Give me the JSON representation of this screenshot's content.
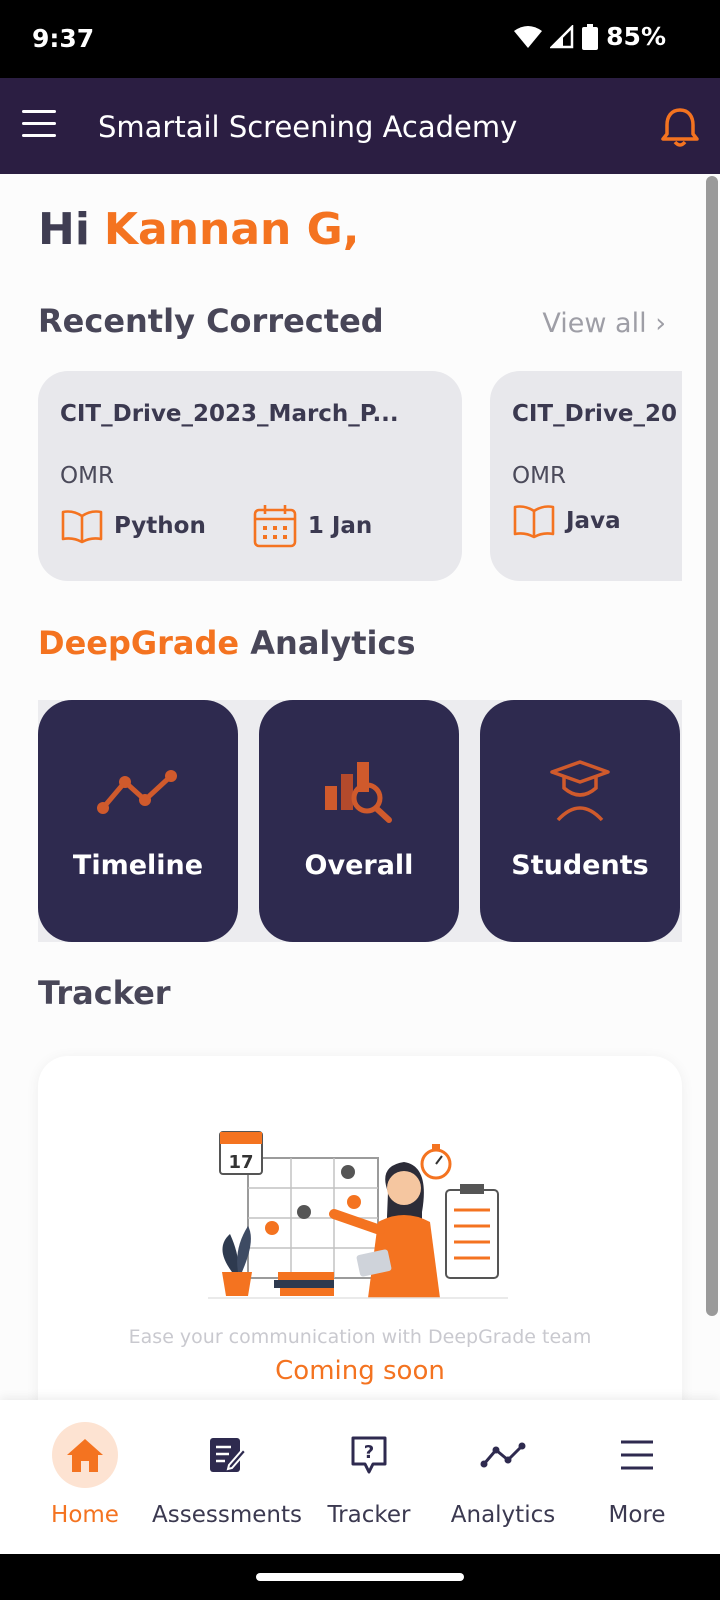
{
  "status_bar": {
    "time": "9:37",
    "battery": "85%"
  },
  "header": {
    "title": "Smartail Screening Academy"
  },
  "greeting": {
    "hi": "Hi",
    "name": "Kannan G,"
  },
  "recently_corrected": {
    "title": "Recently Corrected",
    "view_all": "View all ›",
    "cards": [
      {
        "title": "CIT_Drive_2023_March_P...",
        "type": "OMR",
        "subject": "Python",
        "date": "1 Jan"
      },
      {
        "title": "CIT_Drive_20",
        "type": "OMR",
        "subject": "Java"
      }
    ]
  },
  "analytics": {
    "title_accent": "DeepGrade",
    "title_rest": " Analytics",
    "tiles": [
      {
        "label": "Timeline",
        "icon": "trend-line-icon"
      },
      {
        "label": "Overall",
        "icon": "bar-chart-magnifier-icon"
      },
      {
        "label": "Students",
        "icon": "graduation-cap-student-icon"
      }
    ]
  },
  "tracker": {
    "title": "Tracker",
    "illustration_calendar_day": "17",
    "description": "Ease your communication with DeepGrade team",
    "status": "Coming soon"
  },
  "bottom_nav": [
    {
      "label": "Home",
      "icon": "home-icon",
      "active": true
    },
    {
      "label": "Assessments",
      "icon": "assessment-edit-icon",
      "active": false
    },
    {
      "label": "Tracker",
      "icon": "question-bubble-icon",
      "active": false
    },
    {
      "label": "Analytics",
      "icon": "trend-line-icon",
      "active": false
    },
    {
      "label": "More",
      "icon": "menu-lines-icon",
      "active": false
    }
  ],
  "colors": {
    "accent": "#f47320",
    "primary_dark": "#2e2a4f",
    "app_bar": "#2b1e42"
  }
}
